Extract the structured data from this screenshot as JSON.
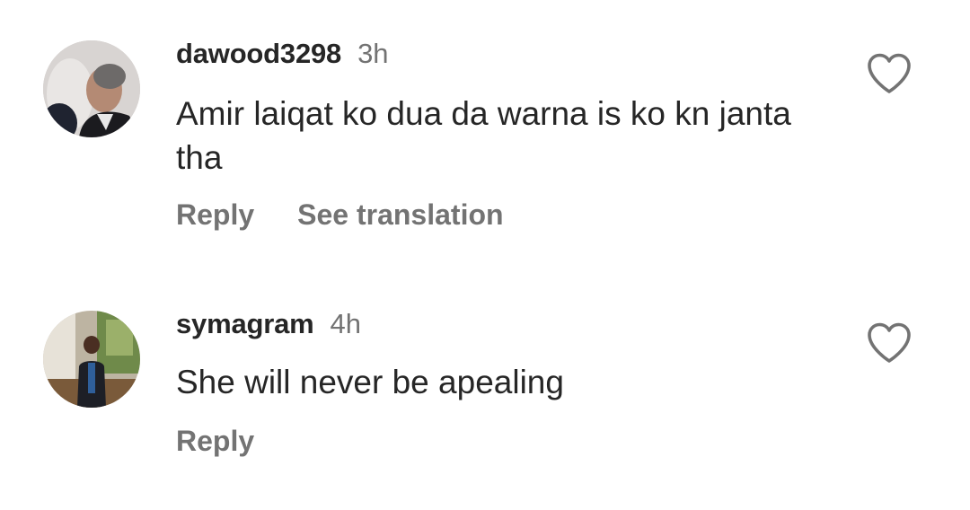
{
  "comments": [
    {
      "username": "dawood3298",
      "time": "3h",
      "text": "Amir laiqat ko dua da warna is ko kn janta tha",
      "actions": {
        "reply": "Reply",
        "translate": "See translation"
      },
      "avatar_icon": "user-avatar-photo",
      "like_icon": "heart-outline-icon"
    },
    {
      "username": "symagram",
      "time": "4h",
      "text": "She will never be apealing",
      "actions": {
        "reply": "Reply"
      },
      "avatar_icon": "user-avatar-photo",
      "like_icon": "heart-outline-icon"
    }
  ],
  "colors": {
    "text_primary": "#262626",
    "text_secondary": "#737373",
    "background": "#ffffff"
  }
}
